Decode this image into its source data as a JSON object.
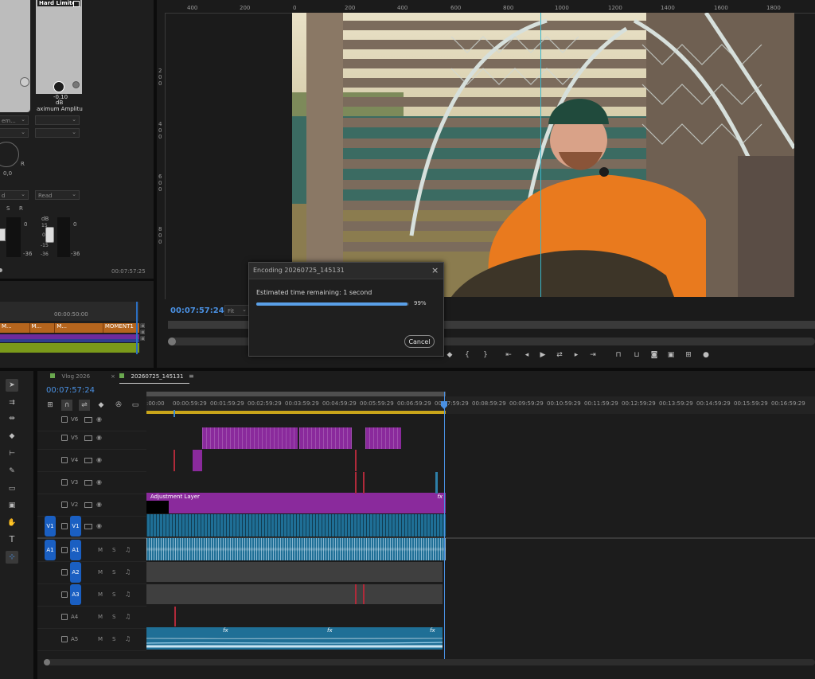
{
  "audio_mixer": {
    "effect_name": "Hard Limiter",
    "db_value": "-0,10",
    "db_unit": "dB",
    "param_name": "aximum Amplitu",
    "left_dropdown": "em...",
    "pan_value": "0,0",
    "pan_r": "R",
    "read_left": "d",
    "read_right": "Read",
    "s_label": "S",
    "r_label": "R",
    "db_label": "dB",
    "meter_scale_left": [
      "0",
      "-36"
    ],
    "meter_scale_right": [
      "15",
      "0",
      "-15",
      "-36"
    ],
    "meter_right_labels": [
      "0",
      "-36"
    ],
    "timecode": "00:07:57:25"
  },
  "source_timeline": {
    "timecode": "00:00:50:00",
    "clips": [
      "M...",
      "M...",
      "M...",
      "MOMENT1"
    ]
  },
  "program_monitor": {
    "ruler_labels": [
      "400",
      "200",
      "0",
      "200",
      "400",
      "600",
      "800",
      "1000",
      "1200",
      "1400",
      "1600",
      "1800"
    ],
    "vruler_labels": [
      "2",
      "0",
      "0",
      "4",
      "0",
      "0",
      "6",
      "0",
      "0",
      "8",
      "0",
      "0"
    ],
    "timecode": "00:07:57:24",
    "fit_label": "Fit"
  },
  "encoding_dialog": {
    "title": "Encoding 20260725_145131",
    "close": "×",
    "status": "Estimated time remaining: 1 second",
    "percent_label": "99%",
    "progress": 0.99,
    "cancel_label": "Cancel"
  },
  "timeline": {
    "tabs": [
      {
        "label": "Vlog 2026",
        "color": "#6aa84f"
      },
      {
        "label": "20260725_145131",
        "color": "#6aa84f"
      }
    ],
    "timecode": "00:07:57:24",
    "ruler_labels": [
      ":00:00",
      "00:00:59:29",
      "00:01:59:29",
      "00:02:59:29",
      "00:03:59:29",
      "00:04:59:29",
      "00:05:59:29",
      "00:06:59:29",
      "00:07:59:29",
      "00:08:59:29",
      "00:09:59:29",
      "00:10:59:29",
      "00:11:59:29",
      "00:12:59:29",
      "00:13:59:29",
      "00:14:59:29",
      "00:15:59:29",
      "00:16:59:29"
    ],
    "video_tracks": [
      "V6",
      "V5",
      "V4",
      "V3",
      "V2",
      "V1"
    ],
    "audio_tracks": [
      "A1",
      "A2",
      "A3",
      "A4",
      "A5"
    ],
    "source_patch_v": "V1",
    "source_patch_a": "A1",
    "m_label": "M",
    "s_label": "S",
    "adjustment_layer_label": "Adjustment Layer",
    "fx_label": "fx",
    "colors": {
      "purple": "#8a2a9c",
      "blue_clip": "#2d7fa8",
      "playhead": "#4a90e2",
      "red_marker": "#b02a3a"
    }
  }
}
